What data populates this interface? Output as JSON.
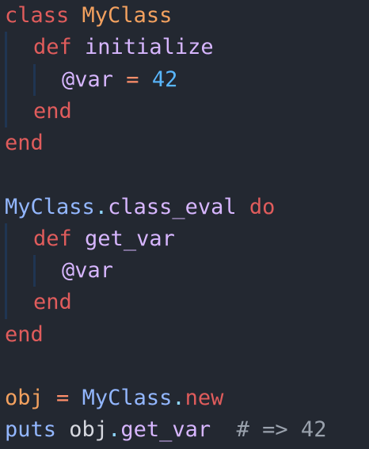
{
  "code": {
    "lines": [
      {
        "t": [
          "class",
          " ",
          "MyClass"
        ]
      },
      {
        "t": [
          "def",
          " ",
          "initialize"
        ]
      },
      {
        "t": [
          "@var",
          " ",
          "=",
          " ",
          "42"
        ]
      },
      {
        "t": [
          "end"
        ]
      },
      {
        "t": [
          "end"
        ]
      },
      {
        "t": []
      },
      {
        "t": [
          "MyClass",
          ".",
          "class_eval",
          " ",
          "do"
        ]
      },
      {
        "t": [
          "def",
          " ",
          "get_var"
        ]
      },
      {
        "t": [
          "@var"
        ]
      },
      {
        "t": [
          "end"
        ]
      },
      {
        "t": [
          "end"
        ]
      },
      {
        "t": []
      },
      {
        "t": [
          "obj",
          " ",
          "=",
          " ",
          "MyClass",
          ".",
          "new"
        ]
      },
      {
        "t": [
          "puts",
          " ",
          "obj",
          ".",
          "get_var",
          "  ",
          "# => 42"
        ]
      }
    ]
  },
  "colors": {
    "background": "#232831",
    "keyword": "#e05c5c",
    "class_name": "#f3a15f",
    "method": "#d7b6ff",
    "number": "#59b7ff",
    "constant": "#93b7ff",
    "comment": "#9aa2ad"
  }
}
